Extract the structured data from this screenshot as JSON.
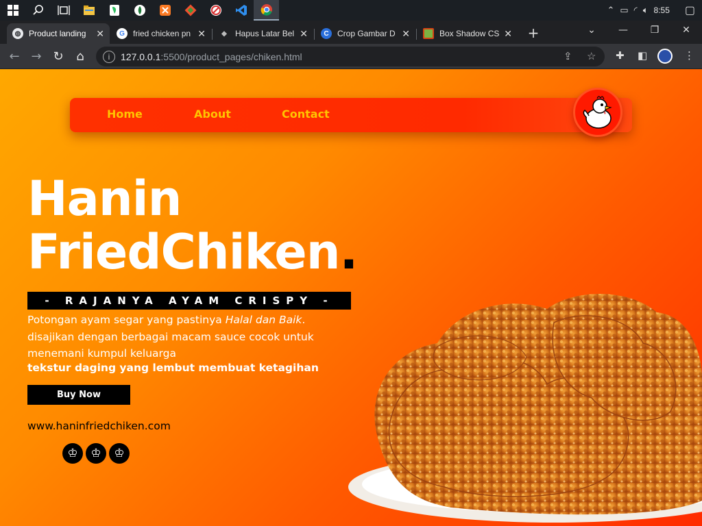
{
  "taskbar": {
    "icons": [
      "windows-start-icon",
      "search-icon",
      "task-view-icon",
      "file-explorer-icon",
      "evernote-icon",
      "app-icon",
      "xampp-icon",
      "git-icon",
      "app-red-icon",
      "vscode-icon",
      "chrome-icon"
    ],
    "time": "8:55"
  },
  "browser": {
    "tabs": [
      {
        "title": "Product landing",
        "active": true
      },
      {
        "title": "fried chicken pn"
      },
      {
        "title": "Hapus Latar Bel"
      },
      {
        "title": "Crop Gambar D"
      },
      {
        "title": "Box Shadow CS"
      }
    ],
    "url_host": "127.0.0.1",
    "url_path": ":5500/product_pages/chiken.html"
  },
  "page": {
    "nav": [
      "Home",
      "About",
      "Contact"
    ],
    "title_line1": "Hanin",
    "title_line2": "FriedChiken",
    "title_dot": ".",
    "tagline": "- RAJANYA AYAM CRISPY -",
    "desc_part1": "Potongan ayam segar yang pastinya ",
    "desc_em": "Halal dan Baik",
    "desc_part2": ".",
    "desc_line2": "disajikan dengan berbagai macam sauce cocok untuk menemani kumpul keluarga",
    "desc_strong": "tekstur daging yang lembut membuat ketagihan",
    "buy_label": "Buy Now",
    "website": "www.haninfriedchiken.com",
    "crown_glyph": "♔"
  },
  "colors": {
    "accent": "#ff2a00",
    "nav_text": "#ffc400",
    "gradient_start": "#ffa800",
    "gradient_end": "#ff2b00"
  }
}
